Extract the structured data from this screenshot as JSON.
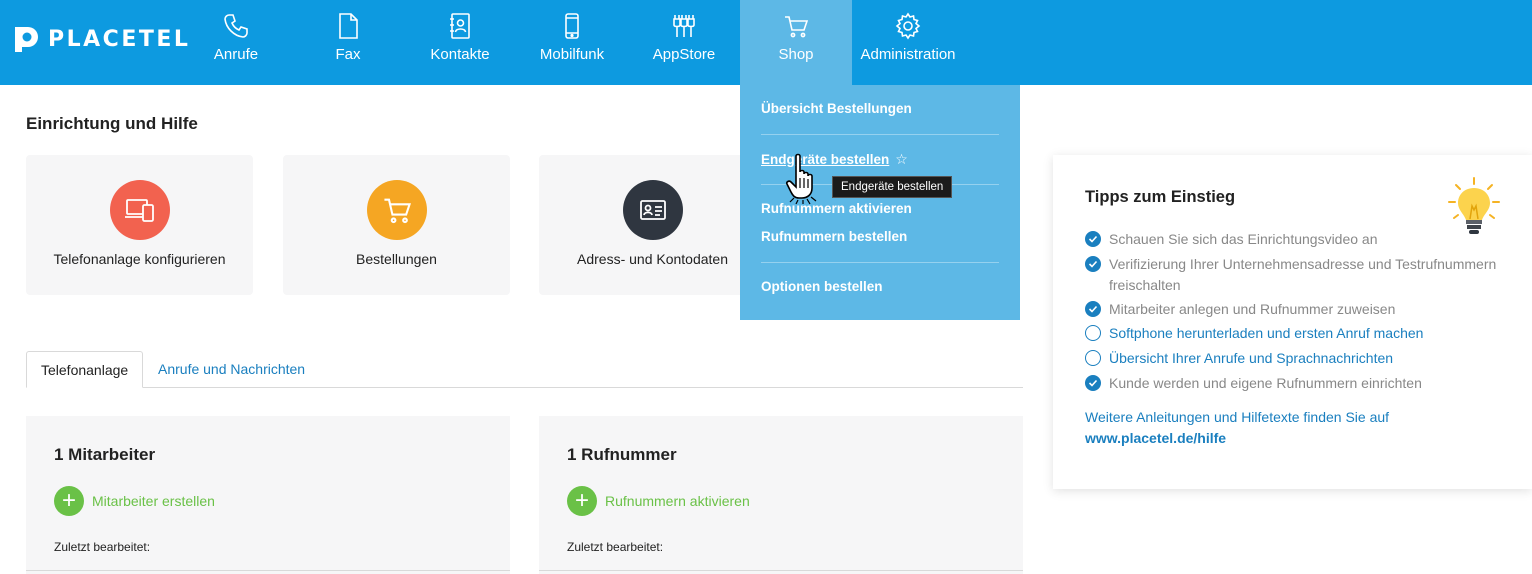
{
  "brand": {
    "name": "PLACETEL"
  },
  "nav": {
    "items": [
      {
        "label": "Anrufe",
        "icon": "phone-icon"
      },
      {
        "label": "Fax",
        "icon": "document-icon"
      },
      {
        "label": "Kontakte",
        "icon": "contacts-icon"
      },
      {
        "label": "Mobilfunk",
        "icon": "mobile-icon"
      },
      {
        "label": "AppStore",
        "icon": "plug-icon"
      },
      {
        "label": "Shop",
        "icon": "cart-icon",
        "active": true
      },
      {
        "label": "Administration",
        "icon": "gear-icon"
      }
    ]
  },
  "shop_menu": {
    "items": [
      "Übersicht Bestellungen",
      "Endgeräte bestellen",
      "Rufnummern aktivieren",
      "Rufnummern bestellen",
      "Optionen bestellen"
    ],
    "hovered_index": 1,
    "tooltip": "Endgeräte bestellen"
  },
  "setup": {
    "title": "Einrichtung und Hilfe",
    "cards": [
      {
        "label": "Telefonanlage konfigurieren",
        "icon": "devices-icon",
        "color": "#f2624f"
      },
      {
        "label": "Bestellungen",
        "icon": "cart-icon",
        "color": "#f5a623"
      },
      {
        "label": "Adress- und Kontodaten",
        "icon": "id-card-icon",
        "color": "#2f3640"
      }
    ]
  },
  "tabs": [
    {
      "label": "Telefonanlage",
      "active": true
    },
    {
      "label": "Anrufe und Nachrichten",
      "active": false
    }
  ],
  "panels": [
    {
      "title": "1 Mitarbeiter",
      "action": "Mitarbeiter erstellen",
      "edited": "Zuletzt bearbeitet:"
    },
    {
      "title": "1 Rufnummer",
      "action": "Rufnummern aktivieren",
      "edited": "Zuletzt bearbeitet:"
    }
  ],
  "tips": {
    "title": "Tipps zum Einstieg",
    "items": [
      {
        "text": "Schauen Sie sich das Einrichtungsvideo an",
        "done": true
      },
      {
        "text": "Verifizierung Ihrer Unternehmensadresse und Testrufnummern freischalten",
        "done": true
      },
      {
        "text": "Mitarbeiter anlegen und Rufnummer zuweisen",
        "done": true
      },
      {
        "text": "Softphone herunterladen und ersten Anruf machen",
        "done": false
      },
      {
        "text": "Übersicht Ihrer Anrufe und Sprachnachrichten",
        "done": false
      },
      {
        "text": "Kunde werden und eigene Rufnummern einrichten",
        "done": true
      }
    ],
    "more_text": "Weitere Anleitungen und Hilfetexte finden Sie auf",
    "more_link": "www.placetel.de/hilfe"
  },
  "colors": {
    "topbar": "#0d9ae0",
    "dropdown": "#5db8e6",
    "link": "#1a7fbf",
    "success": "#6ac147"
  }
}
